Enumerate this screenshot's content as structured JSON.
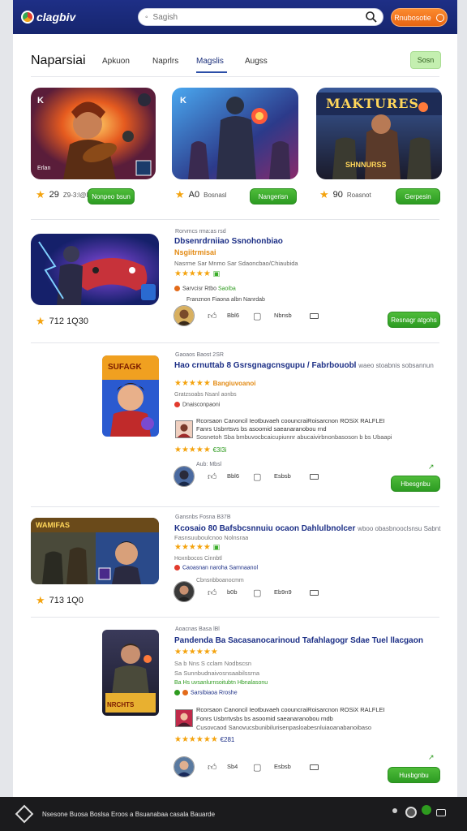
{
  "header": {
    "logo_text": "clagbiv",
    "search_placeholder": "Sagish",
    "cta_label": "Rnubosotie"
  },
  "page": {
    "title": "Naparsiai",
    "tabs": [
      {
        "label": "Apkuon",
        "active": false
      },
      {
        "label": "Naprlrs",
        "active": false
      },
      {
        "label": "Magslis",
        "active": true
      },
      {
        "label": "Augss",
        "active": false
      }
    ],
    "save_label": "Sosn"
  },
  "featured": [
    {
      "badge": "K",
      "caption": "Erlan",
      "rating": "29",
      "sub": "Z9-3:l@ll",
      "button": "Nonpeo bsun"
    },
    {
      "badge": "K",
      "caption": "",
      "rating": "A0",
      "sub": "Bosnasl",
      "button": "Nangerisn"
    },
    {
      "badge": "",
      "caption": "SHNNURSS",
      "banner": "MAKTURES",
      "rating": "90",
      "sub": "Roasnot",
      "button": "Gerpesin"
    }
  ],
  "cards": [
    {
      "rating": "712 1Q30",
      "small": "Rorvmcs rma:as rsd",
      "title": "Dbsenrdrniiao Ssnohonbiao",
      "subtitle": "Nsgiitrmisai",
      "desc": "Nasrme Sar Mnmo Sar Sdaoncbao/Chiaubida",
      "stars": "★★★★★",
      "badge_text": "Sarvcisr Rtbo",
      "badge_green": "Saoiba",
      "meta": "Franznon Fiaona albn Nanrdab",
      "likes": "Bbl6",
      "comments": "Nbnsb",
      "button": "Resnagr atgohs"
    },
    {
      "rating": "",
      "small": "Gaoaos Baost 2SR",
      "title": "Hao crnuttab 8 Gsrsgnagcnsgupu / Fabrbouobl",
      "title_ext": "waeo stoabnis sobsannun",
      "stars": "★★★★★",
      "stars_text": "Bangiuvoanoi",
      "meta": "Gratzsoabs Nsanl aonbs",
      "badge_text": "Dnaisconpaoni",
      "comment1": "Rcorsaon Canoncil Ieotbuvaeh coouncraiRoisarcnon ROSiX RALFLEI",
      "comment2": "Fanrs Usbrrtsvs bs asoomid saeanaranobou rnd",
      "comment3": "Sosnetoh Sba bmbuvocbcaicupiunnr abucaivirbnonbasoson b bs Ubaapi",
      "stars2": "★★★★★",
      "stars2_text": "€3l3i",
      "avatar_sub": "Aub: Mbsl",
      "likes": "Bbl6",
      "comments": "Esbsb",
      "button": "Hbesgnbu"
    },
    {
      "rating": "713 1Q0",
      "small": "Gansnbs Fosna B37B",
      "title": "Kcosaio 80 Bafsbcsnnuiu ocaon Dahlulbnolcer",
      "title_ext": "wboo obasbnooclsnsu Sabnt",
      "small2": "Fasnsuuboulcnoo Nolnsraa",
      "stars": "★★★★★",
      "meta": "Hoxnbocos Cinnbtl",
      "badge_text": "Caoasnan naroha Samnaanol",
      "meta2": "Cbnsnbboanocmm",
      "likes": "b0b",
      "comments": "Eb9n9",
      "button": ""
    },
    {
      "rating": "",
      "small": "Aoacnas Basa lBl",
      "title": "Pandenda Ba Sacasanocarinoud Tafahlagogr Sdae Tuel llacgaon",
      "stars": "★★★★★★",
      "small2": "Sa b Nns S cclam Nodbscsn",
      "small3": "Sa Sunnbudnaivosnsaabilssrna",
      "meta": "Ba Hs uvsanlurnsoitubtn Hbnalasonu",
      "badge_text": "Sarsibiaoa Rroshe",
      "comment1": "Rcorsaon Canoncil Ieotbuvaeh coouncraiRoisarcnon ROSiX RALFLEI",
      "comment2": "Fonrs Usbrrtvsbs bs asoomid saeanaranobou rndb",
      "comment3": "Cusovcaod Sanovucsbunibilurisenpasloabesnluiaoanabanoibaso",
      "stars2": "★★★★★★",
      "stars2_text": "€281",
      "likes": "Sb4",
      "comments": "Esbsb",
      "button": "Husbgnbu"
    }
  ],
  "footer": {
    "text": "Nsesone Buosa Boslsa Eroos a Bsuanabaa casala Bauarde"
  }
}
